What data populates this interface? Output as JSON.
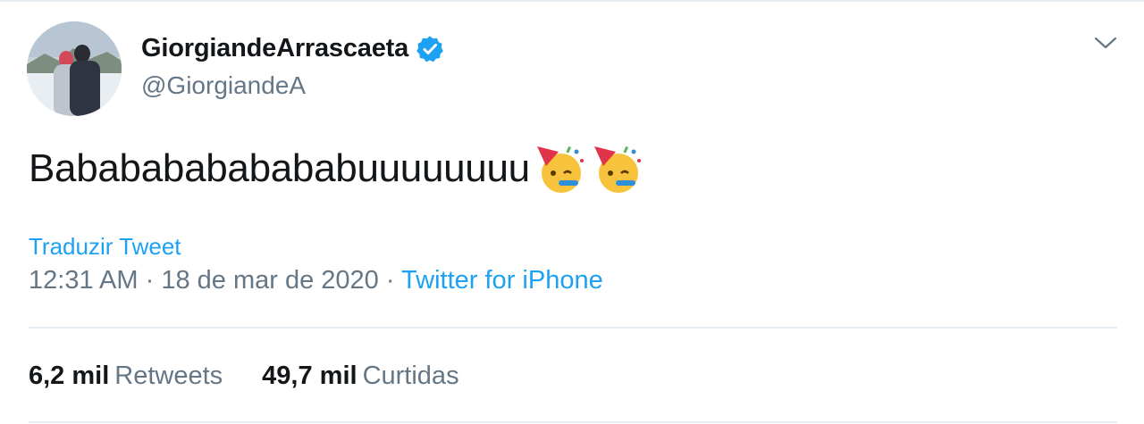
{
  "tweet": {
    "author": {
      "display_name": "GiorgiandeArrascaeta",
      "handle": "@GiorgiandeA",
      "verified": true
    },
    "text": "Babababababababuuuuuuuu",
    "emojis": [
      "partying-face-emoji",
      "partying-face-emoji"
    ],
    "translate_label": "Traduzir Tweet",
    "time": "12:31 AM",
    "date": "18 de mar de 2020",
    "separator": "·",
    "source": "Twitter for iPhone",
    "stats": [
      {
        "value": "6,2 mil",
        "label": "Retweets"
      },
      {
        "value": "49,7 mil",
        "label": "Curtidas"
      }
    ]
  },
  "colors": {
    "link": "#1da1f2",
    "secondary_text": "#657786",
    "primary_text": "#14171a",
    "divider": "#e6ecf0"
  },
  "icons": [
    "verified-badge-icon",
    "chevron-down-icon"
  ]
}
